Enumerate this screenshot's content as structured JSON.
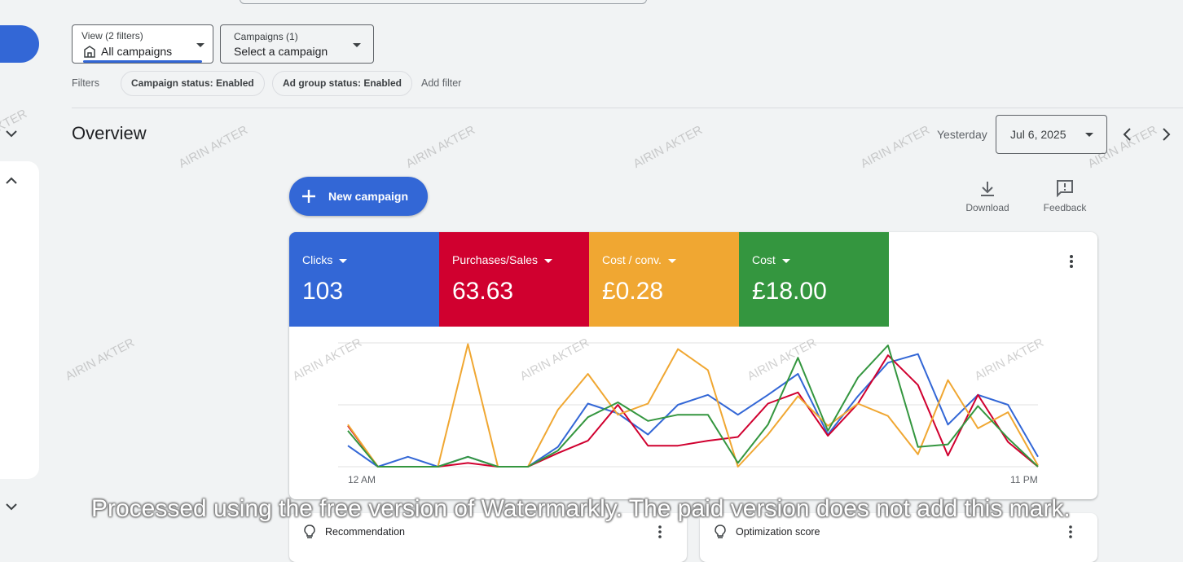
{
  "filters": {
    "view_small": "View (2 filters)",
    "view_main": "All campaigns",
    "campaigns_small": "Campaigns (1)",
    "campaigns_main": "Select a campaign",
    "label": "Filters",
    "chips": [
      "Campaign status: Enabled",
      "Ad group status: Enabled"
    ],
    "add_filter": "Add filter"
  },
  "overview": {
    "title": "Overview",
    "range_label": "Yesterday",
    "date": "Jul 6, 2025"
  },
  "actions": {
    "new_campaign": "New campaign",
    "download": "Download",
    "feedback": "Feedback"
  },
  "metrics": [
    {
      "label": "Clicks",
      "value": "103",
      "color": "#3367d6"
    },
    {
      "label": "Purchases/Sales",
      "value": "63.63",
      "color": "#d0002f"
    },
    {
      "label": "Cost / conv.",
      "value": "£0.28",
      "color": "#f0a732"
    },
    {
      "label": "Cost",
      "value": "£18.00",
      "color": "#34963f"
    }
  ],
  "chart_data": {
    "type": "line",
    "x": [
      "12 AM",
      "1 AM",
      "2 AM",
      "3 AM",
      "4 AM",
      "5 AM",
      "6 AM",
      "7 AM",
      "8 AM",
      "9 AM",
      "10 AM",
      "11 AM",
      "12 PM",
      "1 PM",
      "2 PM",
      "3 PM",
      "4 PM",
      "5 PM",
      "6 PM",
      "7 PM",
      "8 PM",
      "9 PM",
      "10 PM",
      "11 PM"
    ],
    "x_tick_labels": [
      "12 AM",
      "11 PM"
    ],
    "ylim": [
      0,
      100
    ],
    "grid": true,
    "series": [
      {
        "color": "#3367d6",
        "values": [
          17,
          0,
          8,
          0,
          8,
          0,
          0,
          16,
          51,
          43,
          26,
          50,
          58,
          42,
          58,
          75,
          26,
          57,
          84,
          91,
          34,
          58,
          50,
          8
        ]
      },
      {
        "color": "#d0002f",
        "values": [
          33,
          0,
          0,
          0,
          3,
          0,
          0,
          11,
          21,
          50,
          17,
          17,
          21,
          24,
          51,
          60,
          25,
          51,
          90,
          66,
          9,
          58,
          20,
          0
        ]
      },
      {
        "color": "#f0a732",
        "values": [
          34,
          0,
          0,
          0,
          99,
          0,
          0,
          46,
          75,
          42,
          51,
          95,
          78,
          0,
          26,
          57,
          33,
          51,
          41,
          10,
          70,
          31,
          44,
          1
        ]
      },
      {
        "color": "#34963f",
        "values": [
          29,
          0,
          0,
          0,
          8,
          0,
          0,
          13,
          40,
          52,
          37,
          42,
          42,
          3,
          34,
          88,
          29,
          72,
          98,
          16,
          18,
          49,
          23,
          0
        ]
      }
    ]
  },
  "cards": {
    "recommendation": "Recommendation",
    "optimization": "Optimization score"
  },
  "watermark": {
    "name": "AIRIN AKTER",
    "banner": "Processed using the free version of Watermarkly. The paid version does not add this mark."
  }
}
